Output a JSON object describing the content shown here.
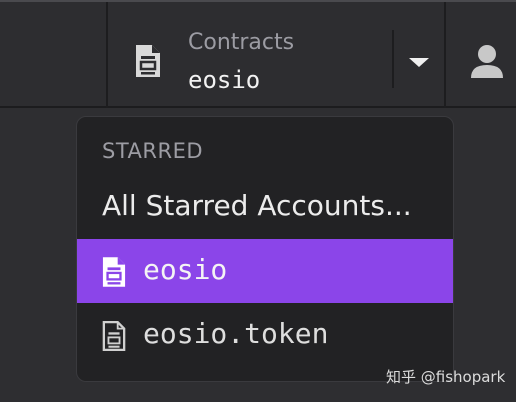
{
  "header": {
    "contract_selector": {
      "label": "Contracts",
      "value": "eosio"
    }
  },
  "dropdown": {
    "section_header": "STARRED",
    "all_starred_label": "All Starred Accounts...",
    "items": [
      {
        "label": "eosio",
        "selected": true
      },
      {
        "label": "eosio.token",
        "selected": false
      }
    ]
  },
  "watermark": "知乎 @fishopark",
  "colors": {
    "selected_background": "#8b45e9",
    "panel_background": "#222224",
    "topbar_background": "#2d2d30"
  },
  "icons": [
    "contract-doc-icon",
    "chevron-down-icon",
    "user-avatar-icon"
  ]
}
